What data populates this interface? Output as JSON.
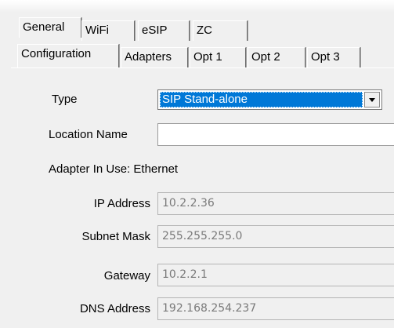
{
  "tabs_row1": [
    "General",
    "WiFi",
    "eSIP",
    "ZC"
  ],
  "tabs_row2": [
    "Configuration",
    "Adapters",
    "Opt 1",
    "Opt 2",
    "Opt 3"
  ],
  "form": {
    "type_label": "Type",
    "type_value": "SIP Stand-alone",
    "location_label": "Location Name",
    "location_value": "",
    "adapter_text": "Adapter In Use: Ethernet",
    "ip_label": "IP Address",
    "ip_value": "10.2.2.36",
    "subnet_label": "Subnet Mask",
    "subnet_value": "255.255.255.0",
    "gateway_label": "Gateway",
    "gateway_value": "10.2.2.1",
    "dns_label": "DNS Address",
    "dns_value": "192.168.254.237"
  },
  "icons": {
    "dropdown": "chevron-down-icon"
  },
  "colors": {
    "selection": "#0078d7",
    "panel": "#f0f0f0"
  }
}
